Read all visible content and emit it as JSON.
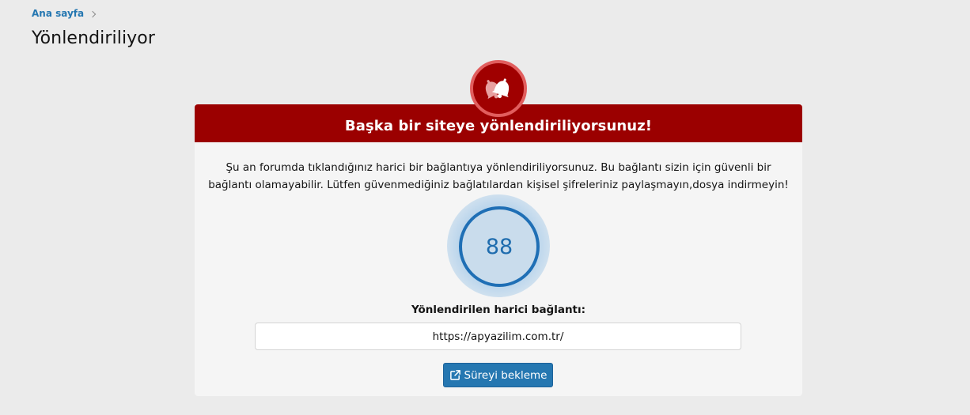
{
  "breadcrumb": {
    "home_label": "Ana sayfa"
  },
  "page": {
    "title": "Yönlendiriliyor"
  },
  "card": {
    "title": "Başka bir siteye yönlendiriliyorsunuz!",
    "description": "Şu an forumda tıklandığınız harici bir bağlantıya yönlendiriliyorsunuz. Bu bağlantı sizin için güvenli bir bağlantı olamayabilir. Lütfen güvenmediğiniz bağlatılardan kişisel şifreleriniz paylaşmayın,dosya indirmeyin!",
    "countdown": "88",
    "link_label": "Yönlendirilen harici bağlantı:",
    "link_value": "https://apyazilim.com.tr/",
    "wait_button_label": "Süreyi bekleme"
  },
  "icons": {
    "alert": "bell-icon",
    "external": "external-link-icon",
    "breadcrumb_separator": "chevron-right-icon"
  },
  "colors": {
    "header": "#9b0000",
    "accent": "#2577b1",
    "badge_ring": "#e15e5e",
    "countdown": "#1f6fb5",
    "background": "#ebebeb",
    "card": "#f5f5f5"
  }
}
